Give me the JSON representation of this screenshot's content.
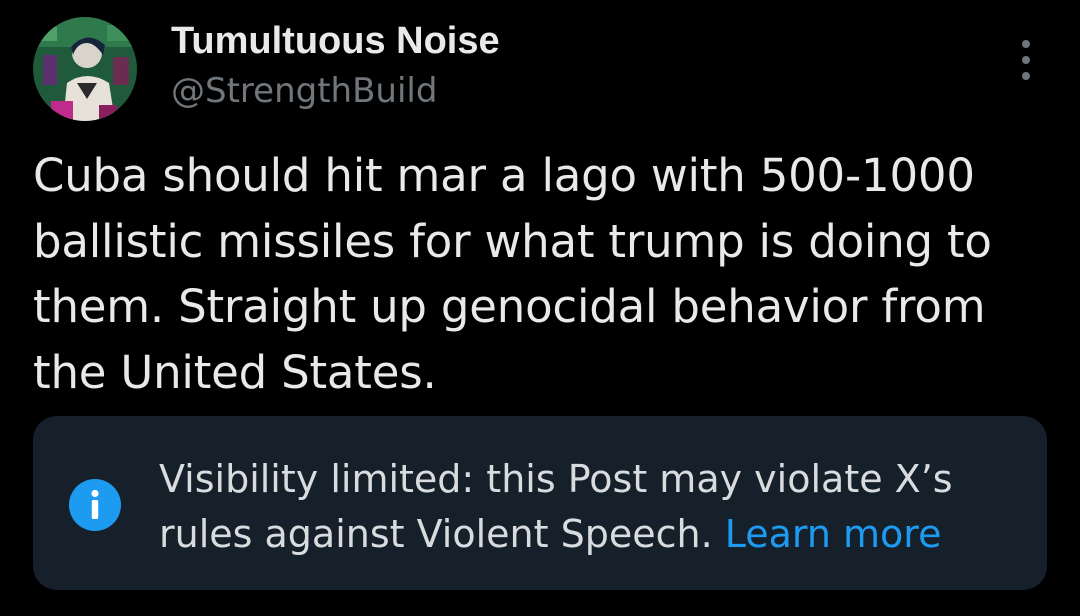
{
  "post": {
    "author": {
      "display_name": "Tumultuous Noise",
      "handle": "@StrengthBuild"
    },
    "text": "Cuba should hit mar a lago with 500-1000 ballistic missiles for what trump is doing to them. Straight up genocidal behavior from the United States.",
    "menu_icon": "more-vertical-icon"
  },
  "notice": {
    "icon": "info-icon",
    "message": "Visibility limited: this Post may violate X’s rules against Violent Speech.",
    "link_label": "Learn more"
  },
  "colors": {
    "background": "#000000",
    "primary_text": "#e7e9ea",
    "secondary_text": "#71767b",
    "notice_background": "#16202a",
    "accent": "#1d9bf0"
  }
}
